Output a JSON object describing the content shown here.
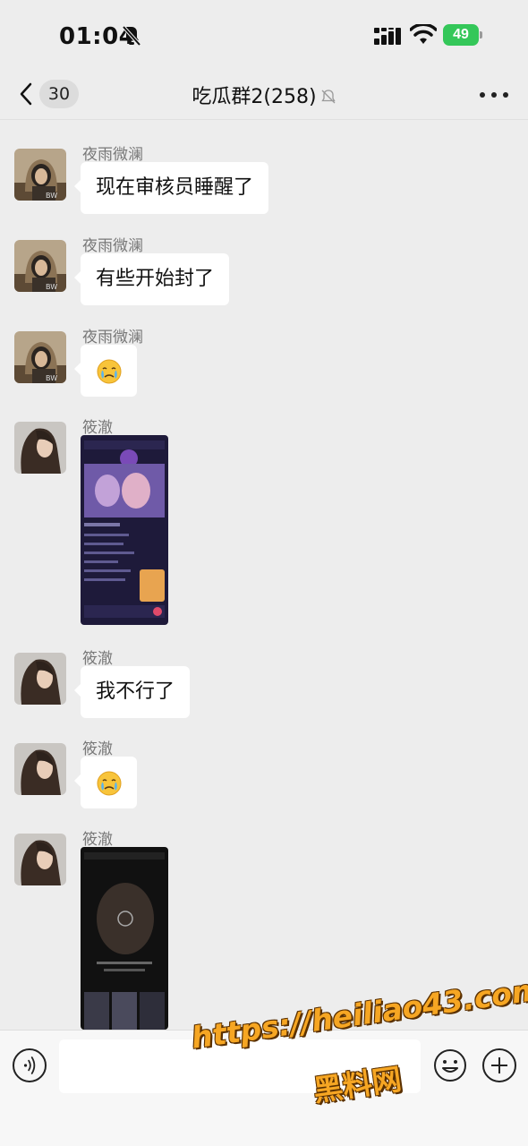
{
  "status_bar": {
    "time": "01:04",
    "battery_level": "49",
    "battery_color": "#34c759",
    "icons": [
      "bell-slash-icon",
      "signal-icon",
      "wifi-icon",
      "battery-icon"
    ]
  },
  "nav": {
    "unread_count": "30",
    "title": "吃瓜群2(258)",
    "icons": [
      "chevron-left-icon",
      "bell-slash-icon",
      "more-icon"
    ]
  },
  "messages": [
    {
      "sender": "夜雨微澜",
      "type": "text",
      "text": "现在审核员睡醒了"
    },
    {
      "sender": "夜雨微澜",
      "type": "text",
      "text": "有些开始封了"
    },
    {
      "sender": "夜雨微澜",
      "type": "emoji",
      "emoji": "crying-face-emoji"
    },
    {
      "sender": "筱澈",
      "type": "image",
      "image": "live-stream-screenshot"
    },
    {
      "sender": "筱澈",
      "type": "text",
      "text": "我不行了"
    },
    {
      "sender": "筱澈",
      "type": "emoji",
      "emoji": "crying-face-emoji"
    },
    {
      "sender": "筱澈",
      "type": "image",
      "image": "video-app-screenshot"
    }
  ],
  "input_bar": {
    "placeholder": "",
    "icons": [
      "voice-icon",
      "emoji-icon",
      "plus-icon"
    ]
  },
  "watermark": {
    "url": "https://heiliao43.com",
    "site_name": "黑料网",
    "color": "#f6a623"
  }
}
